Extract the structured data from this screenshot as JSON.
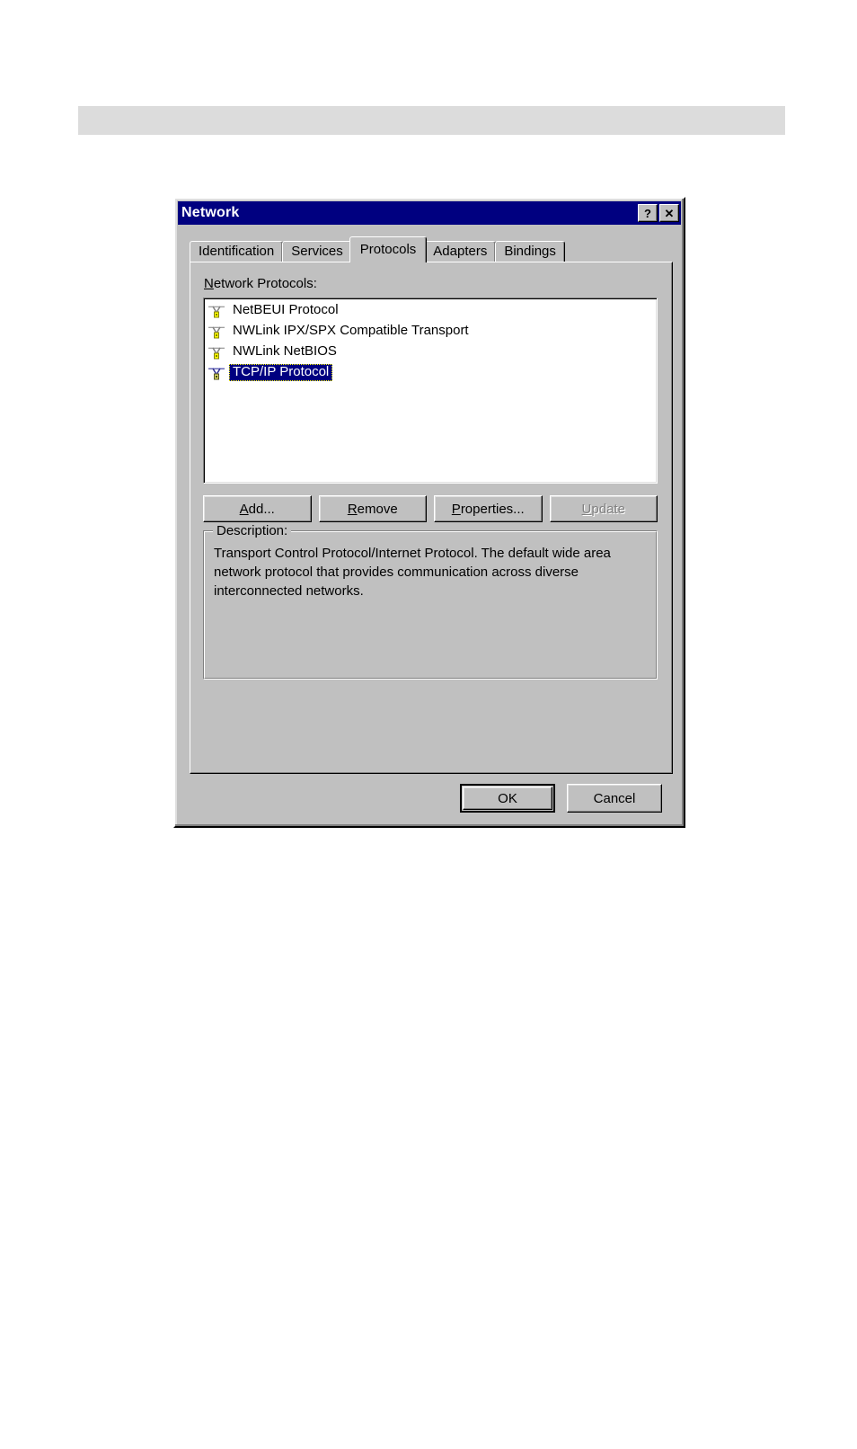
{
  "page": {
    "banner": ""
  },
  "dialog": {
    "title": "Network",
    "titlebar_buttons": [
      {
        "name": "help-button",
        "glyph": "?"
      },
      {
        "name": "close-button",
        "glyph": "✕"
      }
    ],
    "tabs": [
      {
        "label": "Identification",
        "active": false
      },
      {
        "label": "Services",
        "active": false
      },
      {
        "label": "Protocols",
        "active": true
      },
      {
        "label": "Adapters",
        "active": false
      },
      {
        "label": "Bindings",
        "active": false
      }
    ],
    "protocols_label": {
      "accel": "N",
      "rest": "etwork Protocols:"
    },
    "protocol_list": [
      {
        "label": "NetBEUI Protocol",
        "selected": false
      },
      {
        "label": "NWLink IPX/SPX Compatible Transport",
        "selected": false
      },
      {
        "label": "NWLink NetBIOS",
        "selected": false
      },
      {
        "label": "TCP/IP Protocol",
        "selected": true
      }
    ],
    "action_buttons": [
      {
        "name": "add-button",
        "accel": "A",
        "rest": "dd...",
        "disabled": false
      },
      {
        "name": "remove-button",
        "accel": "R",
        "rest": "emove",
        "disabled": false
      },
      {
        "name": "properties-button",
        "accel": "P",
        "rest": "roperties...",
        "disabled": false
      },
      {
        "name": "update-button",
        "accel": "U",
        "rest": "pdate",
        "disabled": true
      }
    ],
    "description": {
      "title": "Description:",
      "text": "Transport Control Protocol/Internet Protocol. The default wide area network protocol that provides communication across diverse interconnected networks."
    },
    "ok_label": "OK",
    "cancel_label": "Cancel",
    "colors": {
      "titlebar": "#000080",
      "face": "#c0c0c0",
      "selection": "#000080",
      "focus_outline": "#ffff00",
      "banner": "#dcdcdc",
      "disabled_text": "#808080"
    }
  }
}
